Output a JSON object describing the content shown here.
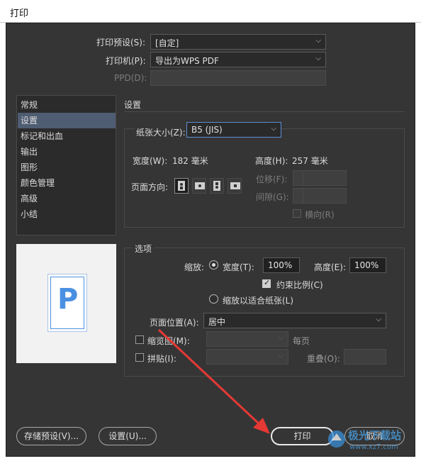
{
  "window": {
    "title": "打印"
  },
  "top": {
    "preset_label": "打印预设(S):",
    "preset_value": "[自定]",
    "printer_label": "打印机(P):",
    "printer_value": "导出为WPS PDF",
    "ppd_label": "PPD(D):",
    "ppd_value": ""
  },
  "sidebar": {
    "items": [
      {
        "label": "常规"
      },
      {
        "label": "设置"
      },
      {
        "label": "标记和出血"
      },
      {
        "label": "输出"
      },
      {
        "label": "图形"
      },
      {
        "label": "颜色管理"
      },
      {
        "label": "高级"
      },
      {
        "label": "小结"
      }
    ],
    "active_index": 1
  },
  "preview": {
    "letter": "P",
    "accent": "#4a90e2"
  },
  "settings": {
    "heading": "设置",
    "paper_size_label": "纸张大小(Z):",
    "paper_size_value": "B5 (JIS)",
    "width_label": "宽度(W):",
    "width_value": "182 毫米",
    "height_label": "高度(H):",
    "height_value": "257 毫米",
    "orientation_label": "页面方向:",
    "offset_label": "位移(F):",
    "gap_label": "间隙(G):",
    "transverse_label": "横向(R)",
    "orientation_icons": [
      "portrait-icon",
      "landscape-icon",
      "reverse-portrait-icon",
      "reverse-landscape-icon"
    ]
  },
  "options": {
    "heading": "选项",
    "scale_label": "缩放:",
    "width_label": "宽度(T):",
    "width_value": "100%",
    "height_label": "高度(E):",
    "height_value": "100%",
    "constrain_label": "约束比例(C)",
    "fit_label": "缩放以适合纸张(L)",
    "page_position_label": "页面位置(A):",
    "page_position_value": "居中",
    "thumbnails_label": "缩览图(M):",
    "per_page_label": "每页",
    "tile_label": "拼贴(I):",
    "overlap_label": "重叠(O):"
  },
  "footer": {
    "save_preset_label": "存储预设(V)...",
    "setup_label": "设置(U)...",
    "print_label": "打印",
    "cancel_label": "取消"
  },
  "watermark": {
    "text": "极光下载站",
    "url_text": "www.xz7.com"
  },
  "colors": {
    "dialog_bg": "#353535",
    "active_nav": "#4f5d72",
    "annotation_arrow": "#e53935"
  }
}
